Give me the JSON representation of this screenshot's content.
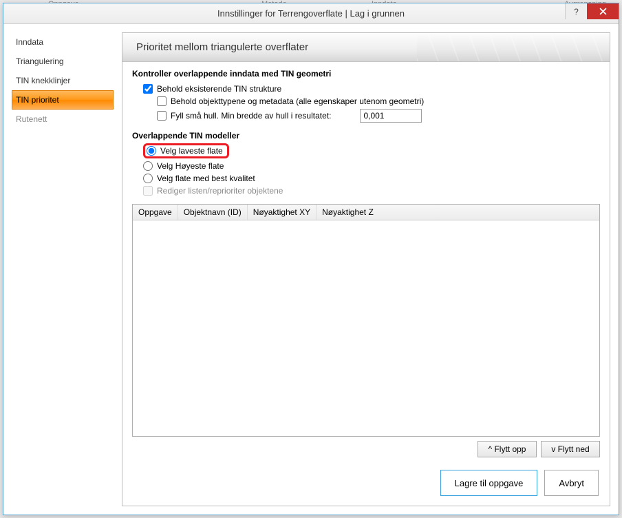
{
  "bg": {
    "left": "Oppgave",
    "mid": "Metode",
    "mid2": "Inndata",
    "right": "Avgrensning"
  },
  "titlebar": {
    "title": "Innstillinger for Terrengoverflate  |  Lag i grunnen",
    "help": "?",
    "close": "×"
  },
  "sidebar": {
    "items": [
      {
        "label": "Inndata"
      },
      {
        "label": "Triangulering"
      },
      {
        "label": "TIN knekklinjer"
      },
      {
        "label": "TIN prioritet",
        "selected": true
      },
      {
        "label": "Rutenett",
        "muted": true
      }
    ]
  },
  "main": {
    "header": "Prioritet mellom triangulerte overflater",
    "section1_title": "Kontroller overlappende inndata med TIN geometri",
    "cb_keep": "Behold eksisterende TIN strukture",
    "cb_keep_meta": "Behold objekttypene og metadata (alle egenskaper utenom geometri)",
    "cb_fill": "Fyll små hull. Min bredde av hull i resultatet:",
    "fill_value": "0,001",
    "section2_title": "Overlappende TIN modeller",
    "radio_low": "Velg laveste flate",
    "radio_high": "Velg Høyeste flate",
    "radio_best": "Velg flate med best kvalitet",
    "cb_edit": "Rediger listen/reprioriter objektene",
    "grid": {
      "cols": [
        "Oppgave",
        "Objektnavn (ID)",
        "Nøyaktighet XY",
        "Nøyaktighet Z"
      ]
    },
    "move_up": "^ Flytt opp",
    "move_down": "v Flytt ned"
  },
  "footer": {
    "save": "Lagre til oppgave",
    "cancel": "Avbryt"
  }
}
